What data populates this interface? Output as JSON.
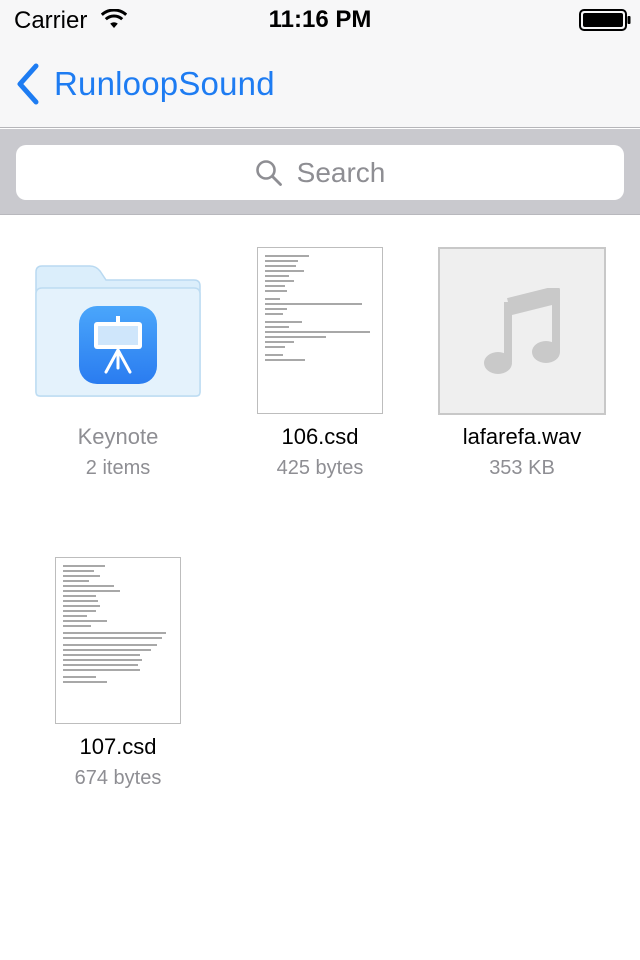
{
  "status_bar": {
    "carrier": "Carrier",
    "time": "11:16 PM",
    "wifi_icon": "wifi-icon",
    "battery_icon": "battery-icon"
  },
  "nav": {
    "back_label": "RunloopSound",
    "back_icon": "chevron-left-icon",
    "accent_color": "#1e7cf2"
  },
  "search": {
    "placeholder": "Search",
    "icon": "search-icon"
  },
  "items": [
    {
      "name": "Keynote",
      "meta": "2 items",
      "type": "folder",
      "icon": "keynote-app-icon"
    },
    {
      "name": "106.csd",
      "meta": "425 bytes",
      "type": "document"
    },
    {
      "name": "lafarefa.wav",
      "meta": "353 KB",
      "type": "audio",
      "icon": "music-note-icon"
    },
    {
      "name": "107.csd",
      "meta": "674 bytes",
      "type": "document"
    }
  ]
}
